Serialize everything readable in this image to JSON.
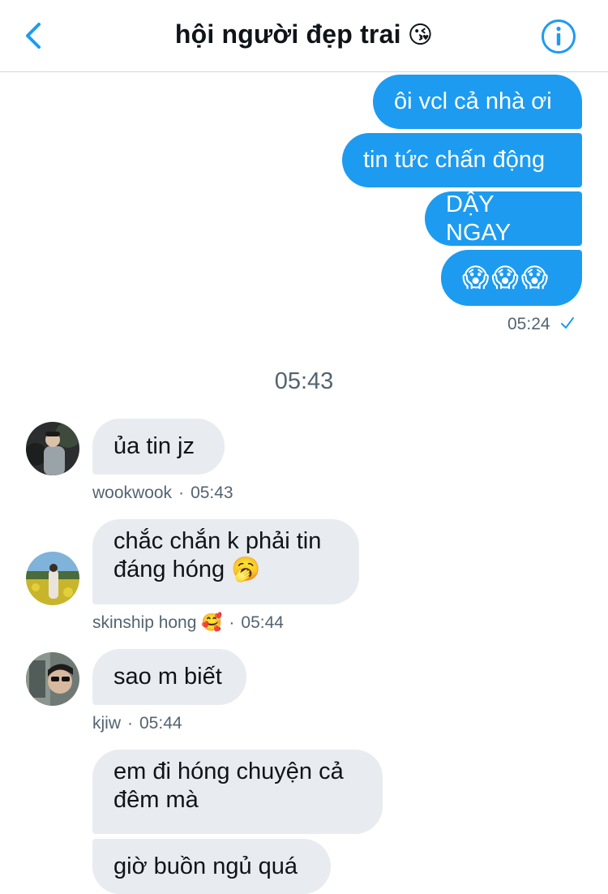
{
  "header": {
    "title": "hội người đẹp trai",
    "title_emoji": "😘",
    "back_icon": "chevron-left-icon",
    "info_icon": "info-circle-icon"
  },
  "messages_out": [
    "ôi vcl cả nhà ơi",
    "tin tức chấn động",
    "DẬY NGAY",
    "😱😱😱"
  ],
  "out_meta": {
    "time": "05:24",
    "status_icon": "check-icon"
  },
  "time_divider": "05:43",
  "messages_in": [
    {
      "text": "ủa tin jz",
      "sender": "wookwook",
      "time": "05:43"
    },
    {
      "text": "chắc chắn k phải tin đáng hóng 🥱",
      "sender": "skinship hong",
      "sender_emoji": "🥰",
      "time": "05:44"
    },
    {
      "text": "sao m biết",
      "sender": "kjiw",
      "time": "05:44"
    },
    {
      "text": "em đi hóng chuyện cả đêm mà"
    },
    {
      "text": "giờ buồn ngủ quá"
    }
  ],
  "colors": {
    "accent": "#1d9bf0",
    "incoming_bg": "#e8ebef",
    "meta": "#536471"
  }
}
